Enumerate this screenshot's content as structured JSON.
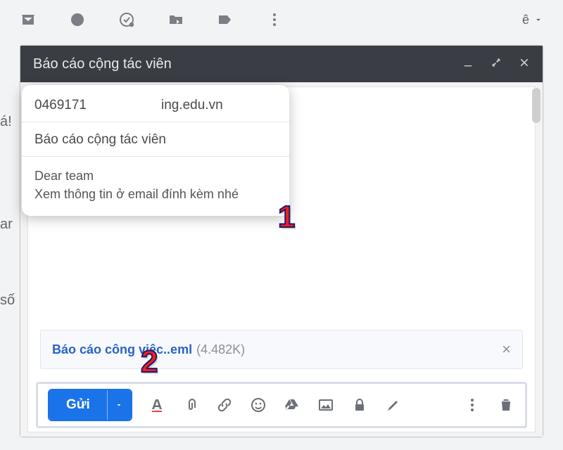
{
  "toolbar": {
    "icons": [
      "archive",
      "snooze",
      "mark-done",
      "move",
      "label",
      "more"
    ],
    "lang_indicator": "ê"
  },
  "compose": {
    "title": "Báo cáo cộng tác viên",
    "to_prefix": "0469171",
    "to_suffix": "ing.edu.vn",
    "subject": "Báo cáo cộng tác viên",
    "body_line1": "Dear team",
    "body_line2": "Xem thông tin ở email đính kèm nhé",
    "attachment": {
      "name": "Báo cáo công việc..eml",
      "size": "(4.482K)"
    },
    "send_label": "Gửi"
  },
  "annotations": {
    "step1": "1",
    "step2": "2"
  },
  "bg_text": {
    "a": "á!",
    "b": "ar",
    "c": "số"
  }
}
